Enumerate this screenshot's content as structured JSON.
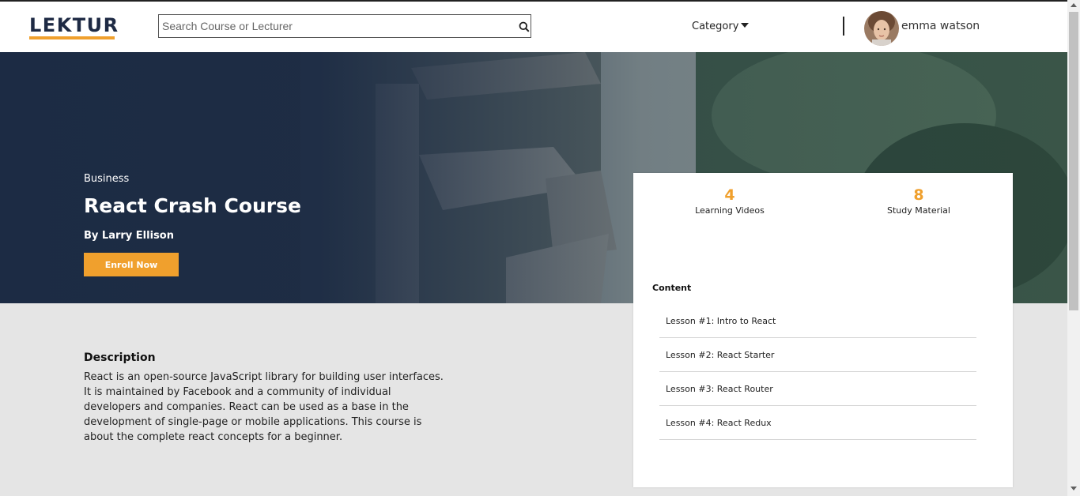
{
  "navbar": {
    "logo_text": "LEKTUR",
    "search_placeholder": "Search Course or Lecturer",
    "category_label": "Category",
    "username": "emma watson"
  },
  "hero": {
    "category": "Business",
    "title": "React Crash Course",
    "author": "By Larry Ellison",
    "enroll_label": "Enroll Now"
  },
  "description": {
    "heading": "Description",
    "body": "React is an open-source JavaScript library for building user interfaces. It is maintained by Facebook and a community of individual developers and companies. React can be used as a base in the development of single-page or mobile applications. This course is about the complete react concepts for a beginner."
  },
  "card": {
    "stats": [
      {
        "value": "4",
        "label": "Learning Videos"
      },
      {
        "value": "8",
        "label": "Study Material"
      }
    ],
    "content_heading": "Content",
    "lessons": [
      {
        "label": "Lesson #1: Intro to React"
      },
      {
        "label": "Lesson #2: React Starter"
      },
      {
        "label": "Lesson #3: React Router"
      },
      {
        "label": "Lesson #4: React Redux"
      }
    ]
  },
  "colors": {
    "accent": "#f0a02d",
    "navy": "#1e2a44",
    "page_bg": "#e5e5e5"
  },
  "icons": [
    "search-icon",
    "chevron-down-icon",
    "avatar"
  ]
}
